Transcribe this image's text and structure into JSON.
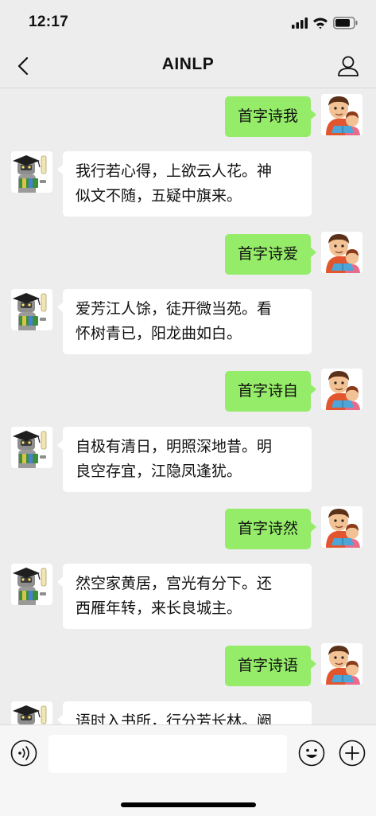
{
  "status_bar": {
    "time": "12:17"
  },
  "nav": {
    "title": "AINLP"
  },
  "messages": [
    {
      "from": "me",
      "text": "首字诗我"
    },
    {
      "from": "bot",
      "lines": [
        "我行若心得，上欲云人花。神",
        "似文不随，五疑中旗来。"
      ]
    },
    {
      "from": "me",
      "text": "首字诗爱"
    },
    {
      "from": "bot",
      "lines": [
        "爱芳江人馀，徒开微当苑。看",
        "怀树青已，阳龙曲如白。"
      ]
    },
    {
      "from": "me",
      "text": "首字诗自"
    },
    {
      "from": "bot",
      "lines": [
        "自极有清日，明照深地昔。明",
        "良空存宜，江隐凤逢犹。"
      ]
    },
    {
      "from": "me",
      "text": "首字诗然"
    },
    {
      "from": "bot",
      "lines": [
        "然空家黄居，宫光有分下。还",
        "西雁年转，来长良城主。"
      ]
    },
    {
      "from": "me",
      "text": "首字诗语"
    },
    {
      "from": "bot",
      "lines": [
        "语时入书所，行分芳长林。阙",
        ""
      ]
    }
  ],
  "input": {
    "placeholder": ""
  },
  "icons": {
    "back": "chevron-left-icon",
    "profile": "person-icon",
    "voice": "voice-icon",
    "emoji": "emoji-icon",
    "plus": "plus-icon"
  },
  "colors": {
    "outgoing_bubble": "#95ec69",
    "incoming_bubble": "#ffffff",
    "background": "#ededed"
  }
}
